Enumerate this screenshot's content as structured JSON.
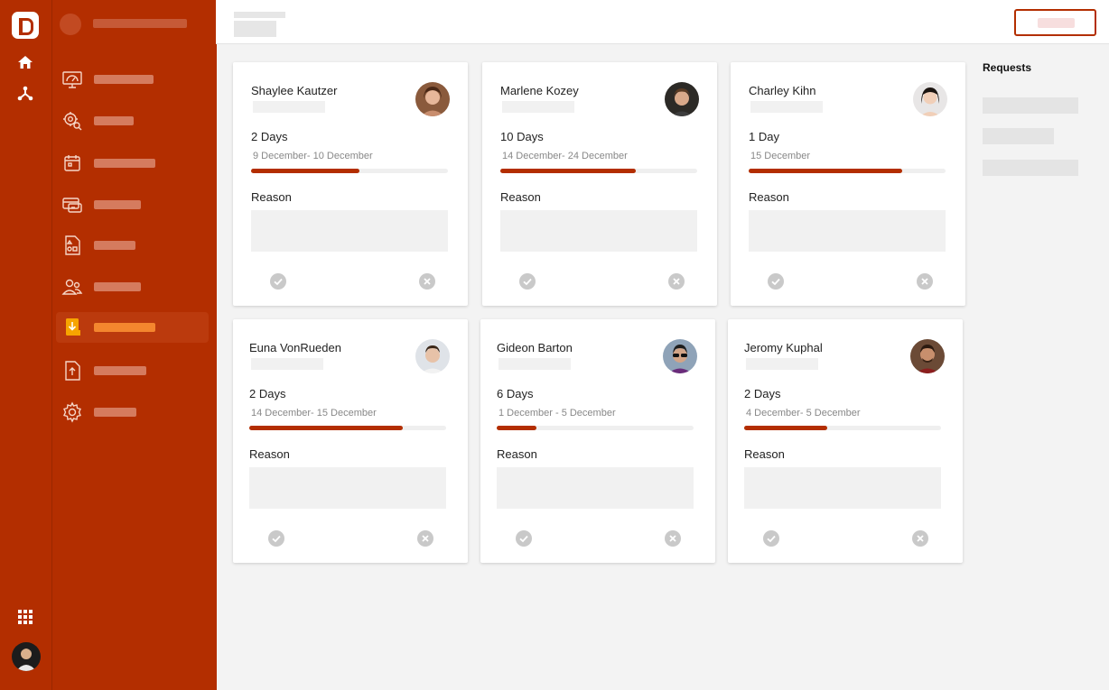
{
  "sidebar": {
    "logo": "D",
    "rail_icons": [
      "home-icon",
      "hierarchy-icon"
    ],
    "bottom_icons": [
      "apps-grid-icon",
      "user-avatar"
    ],
    "nav_items": [
      {
        "icon": "dashboard-icon",
        "active": false
      },
      {
        "icon": "settings-search-icon",
        "active": false
      },
      {
        "icon": "calendar-icon",
        "active": false
      },
      {
        "icon": "payment-icon",
        "active": false
      },
      {
        "icon": "shapes-document-icon",
        "active": false
      },
      {
        "icon": "users-icon",
        "active": false
      },
      {
        "icon": "leave-request-icon",
        "active": true
      },
      {
        "icon": "upload-document-icon",
        "active": false
      },
      {
        "icon": "gear-icon",
        "active": false
      }
    ]
  },
  "colors": {
    "brand": "#b32e00",
    "active_accent": "#f4862e",
    "progress": "#b32e00"
  },
  "requests": {
    "title": "Requests"
  },
  "cards": [
    {
      "name": "Shaylee Kautzer",
      "days": "2 Days",
      "range": "9 December- 10 December",
      "progress": 0.55,
      "reason_label": "Reason"
    },
    {
      "name": "Marlene Kozey",
      "days": "10 Days",
      "range": "14 December- 24 December",
      "progress": 0.69,
      "reason_label": "Reason"
    },
    {
      "name": "Charley Kihn",
      "days": "1 Day",
      "range": "15 December",
      "progress": 0.78,
      "reason_label": "Reason"
    },
    {
      "name": "Euna VonRueden",
      "days": "2 Days",
      "range": "14 December- 15 December",
      "progress": 0.78,
      "reason_label": "Reason"
    },
    {
      "name": "Gideon Barton",
      "days": "6 Days",
      "range": "1 December - 5 December",
      "progress": 0.2,
      "reason_label": "Reason"
    },
    {
      "name": "Jeromy Kuphal",
      "days": "2 Days",
      "range": "4 December- 5 December",
      "progress": 0.42,
      "reason_label": "Reason"
    }
  ]
}
